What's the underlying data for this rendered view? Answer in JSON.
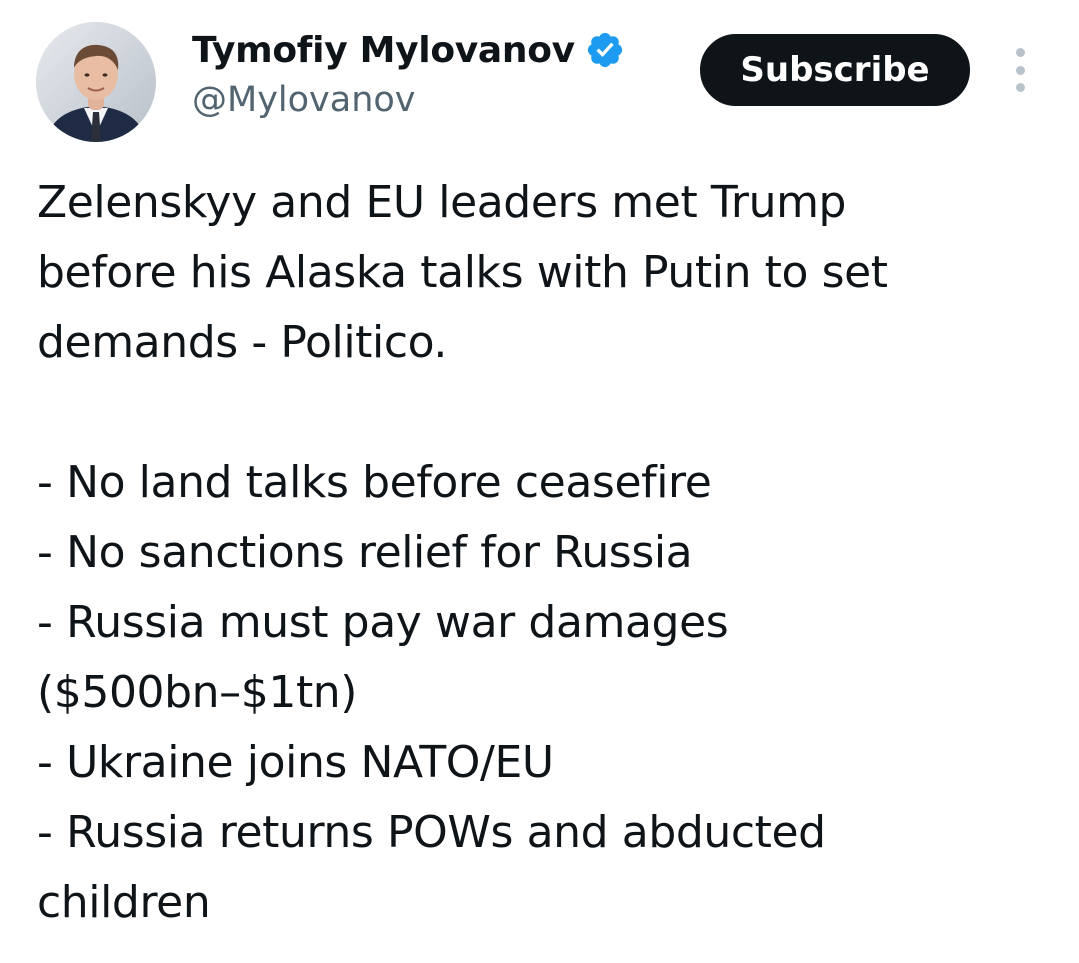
{
  "author": {
    "display_name": "Tymofiy Mylovanov",
    "handle": "@Mylovanov",
    "verified_icon": "verified-badge-icon",
    "verified_color": "#1d9bf0"
  },
  "actions": {
    "subscribe_label": "Subscribe",
    "more_icon": "more-options-icon"
  },
  "tweet": {
    "lines": [
      "Zelenskyy and EU leaders met Trump",
      "before his Alaska talks with Putin to set",
      "demands - Politico.",
      "",
      "- No land talks before ceasefire",
      "- No sanctions relief for Russia",
      "- Russia must pay war damages",
      "($500bn–$1tn)",
      "- Ukraine joins NATO/EU",
      "- Russia returns POWs and abducted",
      "children"
    ]
  },
  "colors": {
    "text": "#0f1419",
    "secondary_text": "#536471",
    "button_bg": "#0f1419",
    "button_text": "#ffffff"
  }
}
